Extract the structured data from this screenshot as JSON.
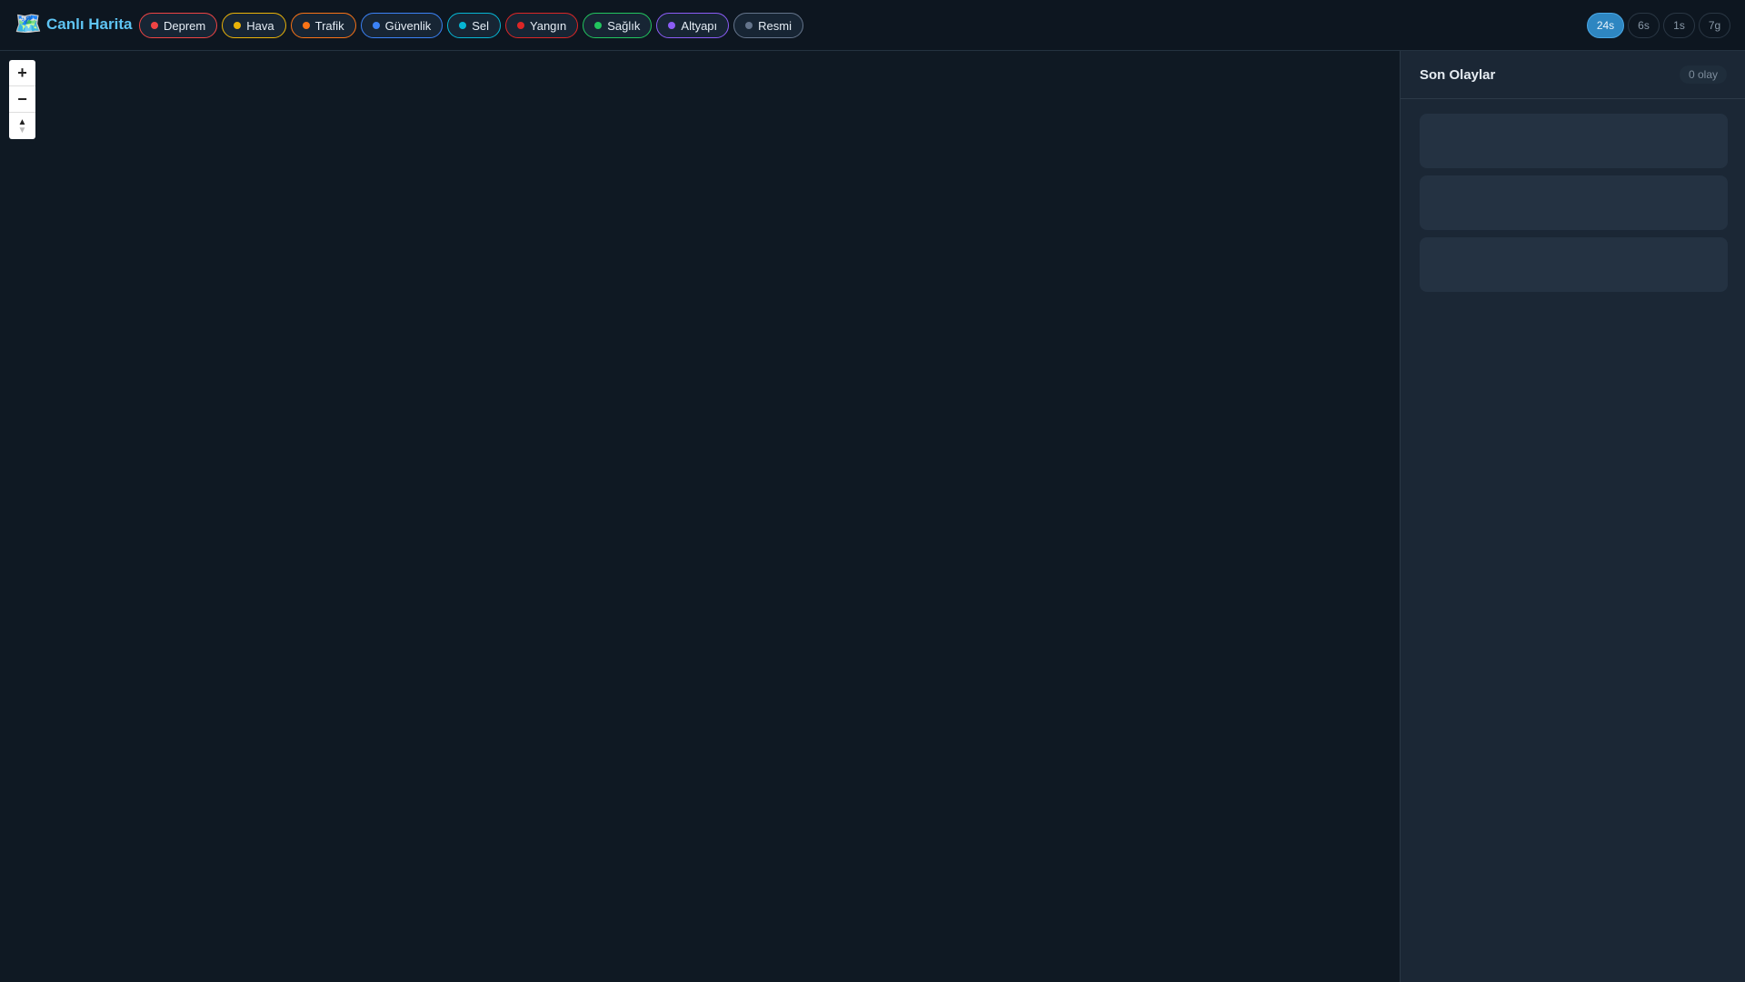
{
  "header": {
    "logo_icon": "world-map-icon",
    "logo_glyph": "🗺️",
    "title": "Canlı Harita"
  },
  "categories": [
    {
      "label": "Deprem",
      "color": "#ef4444"
    },
    {
      "label": "Hava",
      "color": "#eab308"
    },
    {
      "label": "Trafik",
      "color": "#f97316"
    },
    {
      "label": "Güvenlik",
      "color": "#3b82f6"
    },
    {
      "label": "Sel",
      "color": "#06b6d4"
    },
    {
      "label": "Yangın",
      "color": "#dc2626"
    },
    {
      "label": "Sağlık",
      "color": "#22c55e"
    },
    {
      "label": "Altyapı",
      "color": "#8b5cf6"
    },
    {
      "label": "Resmi",
      "color": "#64748b"
    }
  ],
  "time_filters": [
    {
      "label": "24s",
      "active": true
    },
    {
      "label": "6s"
    },
    {
      "label": "1s"
    },
    {
      "label": "7g"
    }
  ],
  "map_controls": {
    "zoom_in": "+",
    "zoom_out": "−"
  },
  "panel": {
    "title": "Son Olaylar",
    "count": "0 olay"
  }
}
